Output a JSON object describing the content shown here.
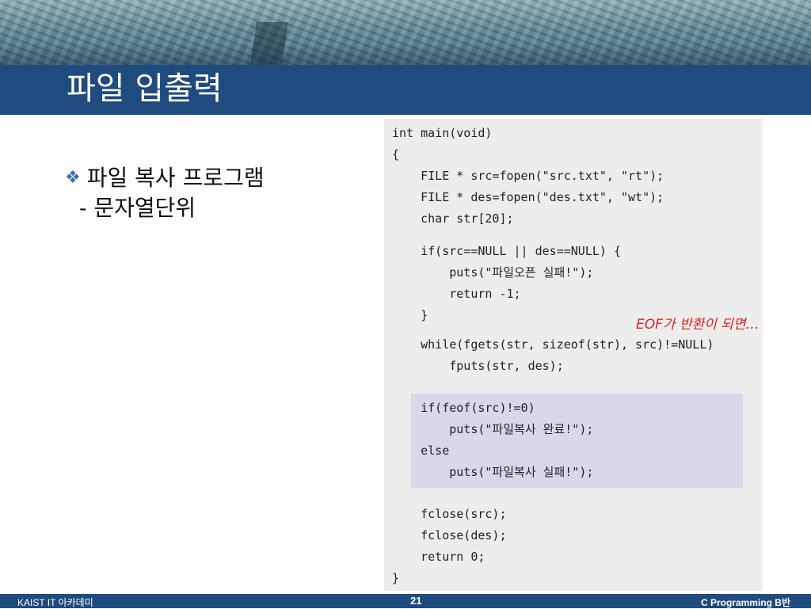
{
  "slide": {
    "title": "파일 입출력",
    "bullet_mark": "❖",
    "bullet_line1": "파일 복사 프로그램",
    "bullet_line2": "- 문자열단위"
  },
  "code": {
    "lines": [
      "int main(void)",
      "{",
      "    FILE * src=fopen(\"src.txt\", \"rt\");",
      "    FILE * des=fopen(\"des.txt\", \"wt\");",
      "    char str[20];",
      "",
      "    if(src==NULL || des==NULL) {",
      "        puts(\"파일오픈 실패!\");",
      "        return -1;",
      "    }",
      "",
      "    while(fgets(str, sizeof(str), src)!=NULL)",
      "        fputs(str, des);",
      "",
      "    if(feof(src)!=0)",
      "        puts(\"파일복사 완료!\");",
      "    else",
      "        puts(\"파일복사 실패!\");",
      "",
      "    fclose(src);",
      "    fclose(des);",
      "    return 0;",
      "}"
    ],
    "annotation": "EOF가 반환이 되면…",
    "annotation_color": "#e02020"
  },
  "footer": {
    "left": "KAIST IT 아카데미",
    "page": "21",
    "right": "C Programming B반"
  },
  "colors": {
    "bar": "#1f4b7e",
    "code_bg": "#ededed",
    "highlight": "#dcd6ea"
  }
}
